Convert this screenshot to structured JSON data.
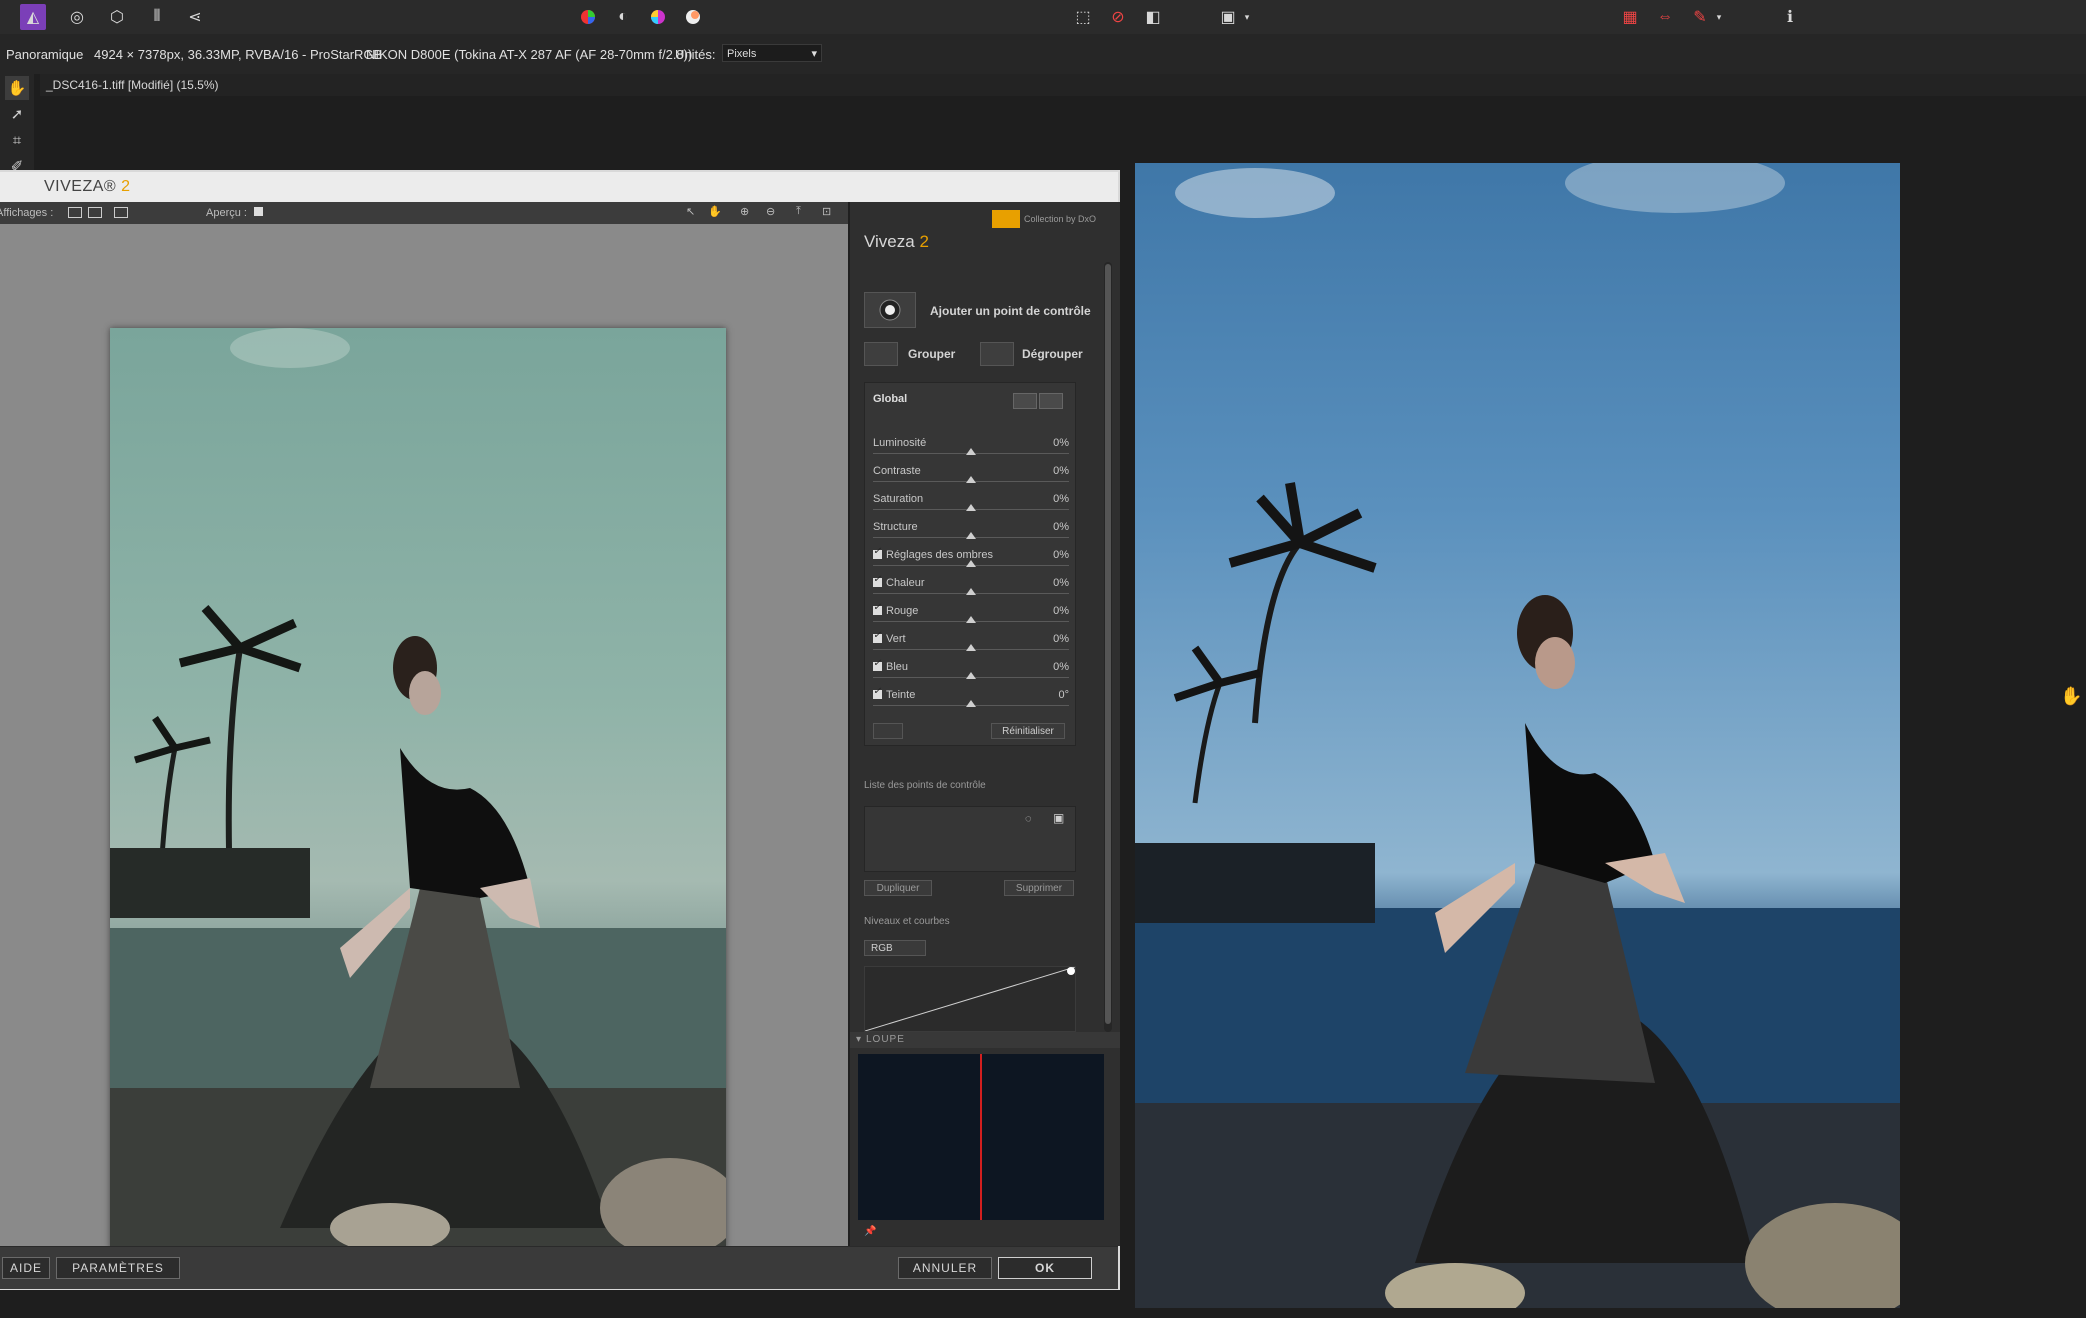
{
  "toolbar": {
    "icons": [
      "affinity-logo-icon",
      "develop-persona-icon",
      "liquify-persona-icon",
      "tone-map-persona-icon",
      "export-persona-icon",
      "color-wheel-icon",
      "contrast-icon",
      "hue-wheel-icon",
      "white-balance-icon",
      "marquee-icon",
      "no-selection-icon",
      "mask-icon",
      "quick-mask-icon",
      "grid-icon",
      "split-icon",
      "assistant-icon",
      "info-icon"
    ]
  },
  "context": {
    "persona": "Panoramique",
    "dimensions": "4924 × 7378px, 36.33MP, RVBA/16 - ProStarRGB",
    "camera": "NIKON D800E (Tokina AT-X 287 AF (AF 28-70mm f/2.8))",
    "units_label": "Unités:",
    "units_value": "Pixels"
  },
  "document_tab": {
    "title": "_DSC416-1.tiff [Modifié] (15.5%)"
  },
  "viveza": {
    "title": "VIVEZA",
    "title_suffix": "2",
    "views_label": "Affichages :",
    "preview_label": "Aperçu :",
    "panel_title": "Viveza",
    "panel_title_num": "2",
    "brand": "Collection by DxO",
    "add_point": "Ajouter un point de contrôle",
    "group": "Grouper",
    "ungroup": "Dégrouper",
    "global": "Global",
    "sliders": [
      {
        "label": "Luminosité",
        "value": "0%",
        "checkbox": false
      },
      {
        "label": "Contraste",
        "value": "0%",
        "checkbox": false
      },
      {
        "label": "Saturation",
        "value": "0%",
        "checkbox": false
      },
      {
        "label": "Structure",
        "value": "0%",
        "checkbox": false
      },
      {
        "label": "Réglages des ombres",
        "value": "0%",
        "checkbox": true
      },
      {
        "label": "Chaleur",
        "value": "0%",
        "checkbox": true
      },
      {
        "label": "Rouge",
        "value": "0%",
        "checkbox": true
      },
      {
        "label": "Vert",
        "value": "0%",
        "checkbox": true
      },
      {
        "label": "Bleu",
        "value": "0%",
        "checkbox": true
      },
      {
        "label": "Teinte",
        "value": "0°",
        "checkbox": true
      }
    ],
    "reset": "Réinitialiser",
    "cp_list": "Liste des points de contrôle",
    "duplicate": "Dupliquer",
    "delete": "Supprimer",
    "levels": "Niveaux et courbes",
    "channel": "RGB",
    "loupe": "LOUPE",
    "help": "AIDE",
    "settings": "PARAMÈTRES",
    "cancel": "ANNULER",
    "ok": "OK"
  }
}
